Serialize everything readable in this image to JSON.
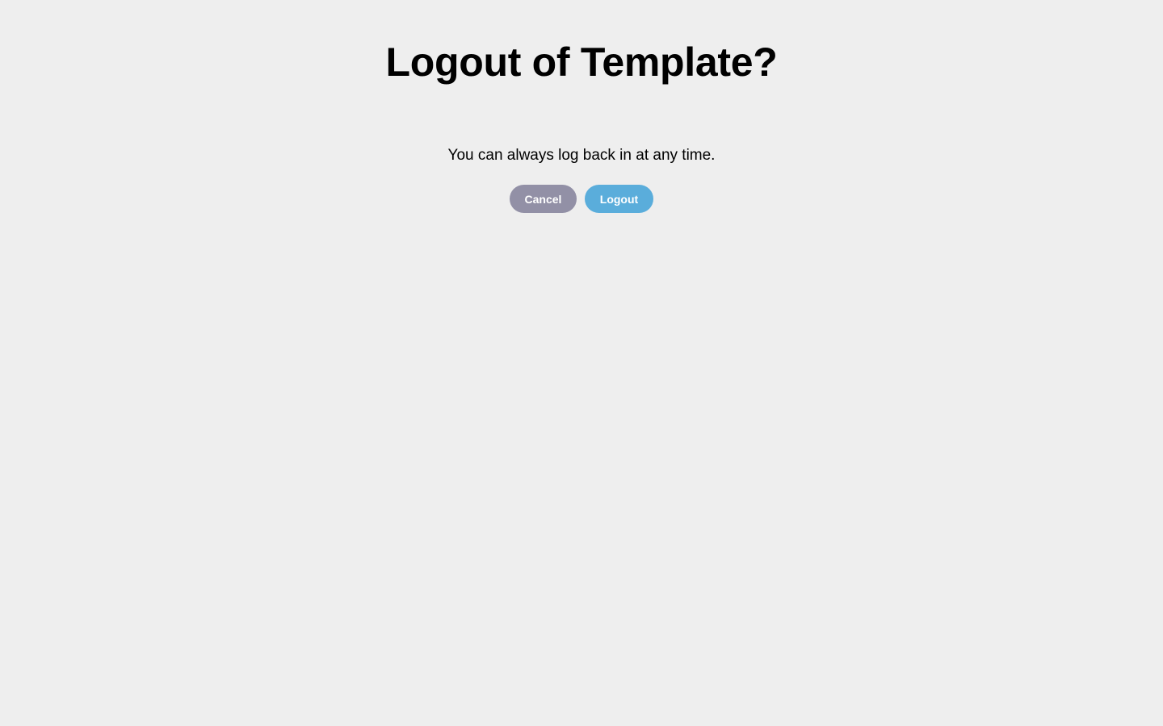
{
  "dialog": {
    "title": "Logout of Template?",
    "message": "You can always log back in at any time.",
    "cancel_label": "Cancel",
    "logout_label": "Logout"
  },
  "colors": {
    "background": "#eeeeee",
    "cancel_button": "#9290a6",
    "logout_button": "#5aaddb",
    "button_text": "#ffffff"
  }
}
